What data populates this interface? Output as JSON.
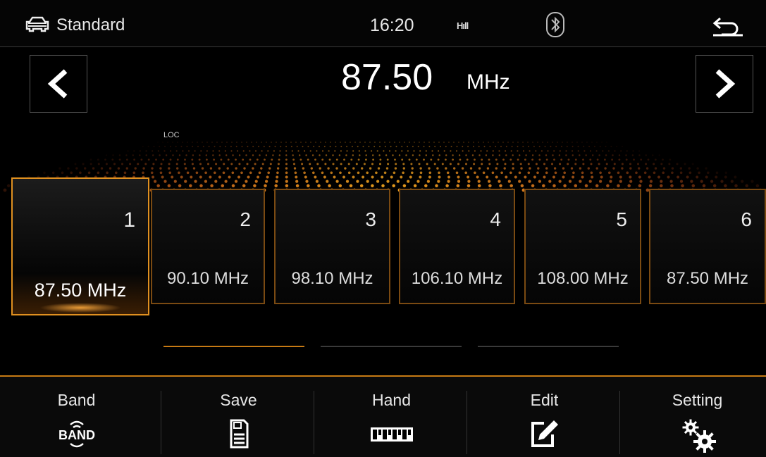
{
  "status": {
    "mode": "Standard",
    "time": "16:20",
    "signal": "Hıll",
    "icons": [
      "car-icon",
      "signal-icon",
      "bluetooth-icon",
      "back-icon"
    ]
  },
  "tuner": {
    "frequency": "87.50",
    "unit": "MHz",
    "loc_label": "LOC",
    "prev_icon": "chevron-left-icon",
    "next_icon": "chevron-right-icon"
  },
  "presets": [
    {
      "num": "1",
      "freq": "87.50 MHz",
      "active": true
    },
    {
      "num": "2",
      "freq": "90.10 MHz",
      "active": false
    },
    {
      "num": "3",
      "freq": "98.10 MHz",
      "active": false
    },
    {
      "num": "4",
      "freq": "106.10 MHz",
      "active": false
    },
    {
      "num": "5",
      "freq": "108.00 MHz",
      "active": false
    },
    {
      "num": "6",
      "freq": "87.50 MHz",
      "active": false
    }
  ],
  "page_indicator": {
    "count": 3,
    "current": 1
  },
  "tabs": [
    {
      "label": "Band",
      "icon": "band-icon"
    },
    {
      "label": "Save",
      "icon": "save-icon"
    },
    {
      "label": "Hand",
      "icon": "hand-tune-icon"
    },
    {
      "label": "Edit",
      "icon": "edit-icon"
    },
    {
      "label": "Setting",
      "icon": "settings-gears-icon"
    }
  ],
  "colors": {
    "accent": "#e09020",
    "accent_dim": "#7a4a12",
    "background": "#000000"
  }
}
